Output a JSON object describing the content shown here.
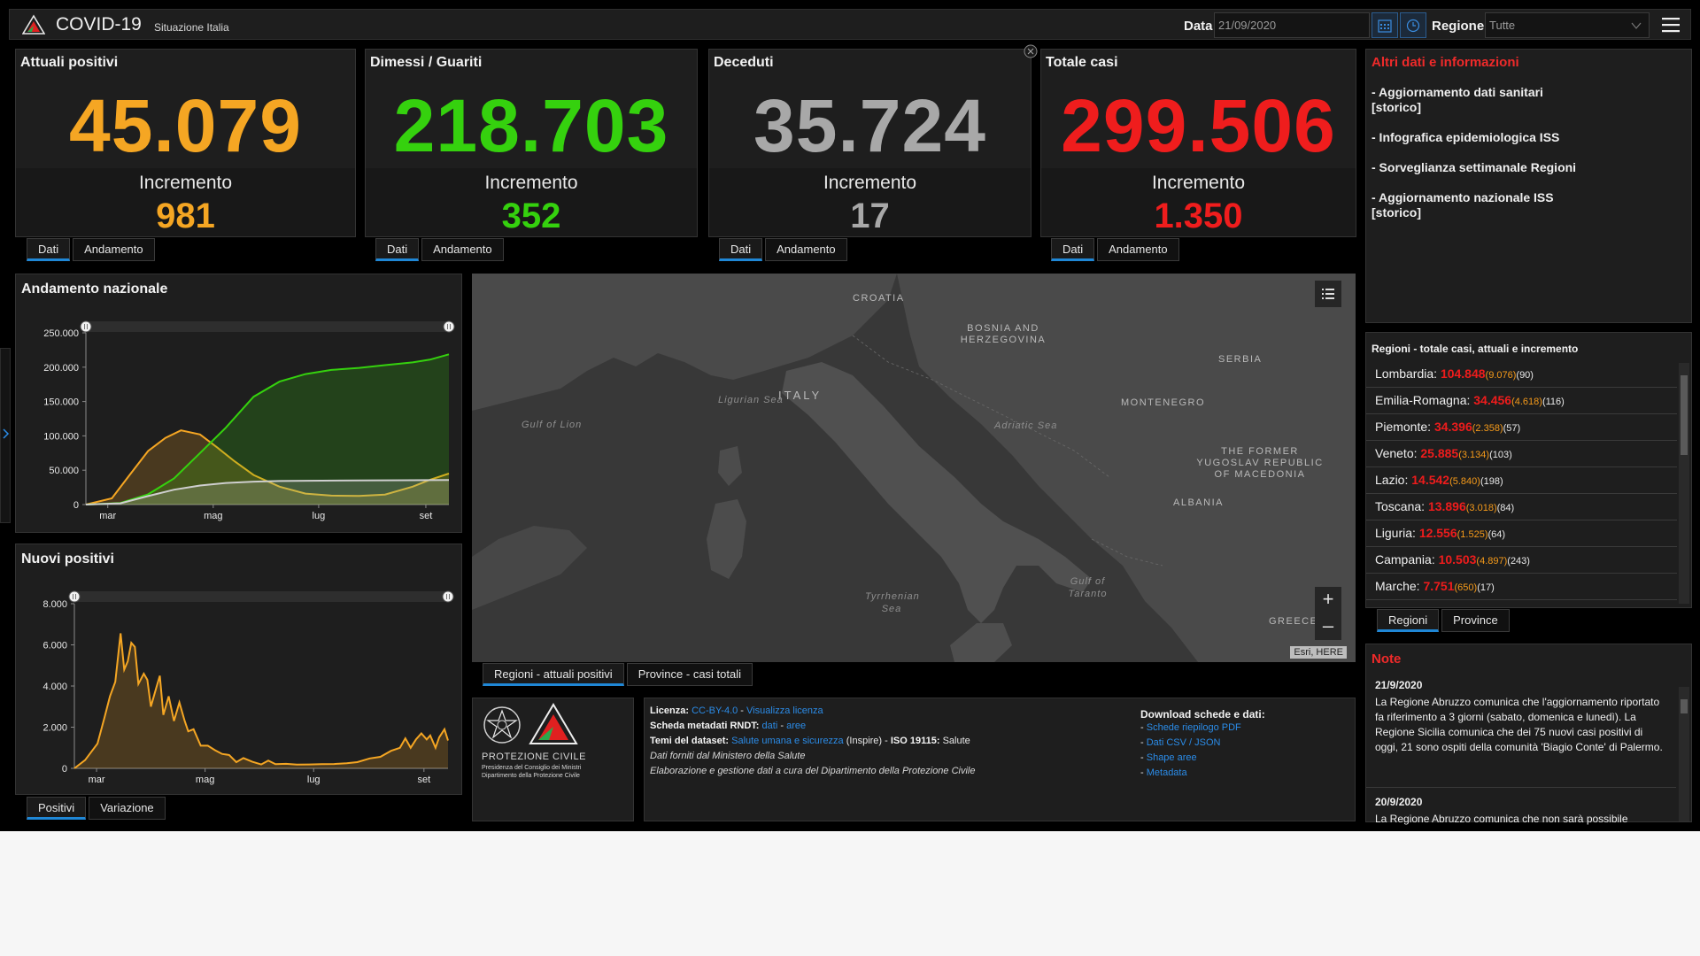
{
  "header": {
    "title": "COVID-19",
    "subtitle": "Situazione Italia",
    "date_label": "Data",
    "date_value": "21/09/2020",
    "region_label": "Regione",
    "region_value": "Tutte"
  },
  "kpis": [
    {
      "title": "Attuali positivi",
      "value": "45.079",
      "increment_label": "Incremento",
      "increment": "981",
      "color": "#f5a623"
    },
    {
      "title": "Dimessi / Guariti",
      "value": "218.703",
      "increment_label": "Incremento",
      "increment": "352",
      "color": "#35d10e"
    },
    {
      "title": "Deceduti",
      "value": "35.724",
      "increment_label": "Incremento",
      "increment": "17",
      "color": "#a8a8a8"
    },
    {
      "title": "Totale casi",
      "value": "299.506",
      "increment_label": "Incremento",
      "increment": "1.350",
      "color": "#ef1d1d"
    }
  ],
  "kpi_tabs": {
    "data": "Dati",
    "trend": "Andamento"
  },
  "info": {
    "title": "Altri dati e informazioni",
    "items": [
      "- Aggiornamento dati sanitari [storico]",
      "- Infografica epidemiologica ISS",
      "- Sorveglianza settimanale Regioni",
      "- Aggiornamento nazionale ISS [storico]"
    ]
  },
  "regions": {
    "title": "Regioni - totale casi, attuali e incremento",
    "rows": [
      {
        "name": "Lombardia:",
        "total": "104.848",
        "current": "(9.076)",
        "inc": "(90)"
      },
      {
        "name": "Emilia-Romagna:",
        "total": "34.456",
        "current": "(4.618)",
        "inc": "(116)"
      },
      {
        "name": "Piemonte:",
        "total": "34.396",
        "current": "(2.358)",
        "inc": "(57)"
      },
      {
        "name": "Veneto:",
        "total": "25.885",
        "current": "(3.134)",
        "inc": "(103)"
      },
      {
        "name": "Lazio:",
        "total": "14.542",
        "current": "(5.840)",
        "inc": "(198)"
      },
      {
        "name": "Toscana:",
        "total": "13.896",
        "current": "(3.018)",
        "inc": "(84)"
      },
      {
        "name": "Liguria:",
        "total": "12.556",
        "current": "(1.525)",
        "inc": "(64)"
      },
      {
        "name": "Campania:",
        "total": "10.503",
        "current": "(4.897)",
        "inc": "(243)"
      },
      {
        "name": "Marche:",
        "total": "7.751",
        "current": "(650)",
        "inc": "(17)"
      }
    ],
    "tabs": [
      "Regioni",
      "Province"
    ]
  },
  "notes": {
    "title": "Note",
    "items": [
      {
        "date": "21/9/2020",
        "text": "La Regione Abruzzo comunica che l'aggiornamento riportato fa riferimento a 3 giorni (sabato, domenica e lunedì). La Regione Sicilia comunica che dei 75 nuovi casi positivi di oggi, 21 sono ospiti della comunità 'Biagio Conte' di Palermo."
      },
      {
        "date": "20/9/2020",
        "text": "La Regione Abruzzo comunica che non sarà possibile"
      }
    ]
  },
  "national": {
    "title": "Andamento nazionale",
    "tabs": []
  },
  "new_positive": {
    "title": "Nuovi positivi",
    "tabs": [
      "Positivi",
      "Variazione"
    ]
  },
  "map": {
    "labels": {
      "croatia": "CROATIA",
      "bosnia": "BOSNIA AND HERZEGOVINA",
      "serbia": "SERBIA",
      "italy": "ITALY",
      "montenegro": "MONTENEGRO",
      "macedonia": "THE FORMER YUGOSLAV REPUBLIC OF MACEDONIA",
      "albania": "ALBANIA",
      "greece": "GREECE"
    },
    "seas": {
      "ligurian": "Ligurian Sea",
      "lion": "Gulf of Lion",
      "adriatic": "Adriatic Sea",
      "tyrrhenian": "Tyrrhenian Sea",
      "taranto": "Gulf of Taranto"
    },
    "attribution": "Esri, HERE",
    "zoom_in": "+",
    "zoom_out": "–",
    "tabs": [
      "Regioni - attuali positivi",
      "Province - casi totali"
    ]
  },
  "license": {
    "l1_label": "Licenza:",
    "l1_link1": "CC-BY-4.0",
    "l1_sep": " - ",
    "l1_link2": "Visualizza licenza",
    "l2_label": "Scheda metadati RNDT:",
    "l2_link1": "dati",
    "l2_sep": " - ",
    "l2_link2": "aree",
    "l3_label": "Temi del dataset:",
    "l3_link": "Salute umana e sicurezza",
    "l3_rest1": " (Inspire) - ",
    "l3_bold": "ISO 19115:",
    "l3_rest2": " Salute",
    "l4": "Dati forniti dal Ministero della Salute",
    "l5": "Elaborazione e gestione dati a cura del Dipartimento della Protezione Civile",
    "download_title": "Download schede e dati:",
    "downloads": [
      "Schede riepilogo PDF",
      "Dati CSV / JSON",
      "Shape aree",
      "Metadata"
    ]
  },
  "protezione": {
    "name": "PROTEZIONE CIVILE",
    "line1": "Presidenza del Consiglio dei Ministri",
    "line2": "Dipartimento della Protezione Civile"
  },
  "colors": {
    "attuali": "#f5a623",
    "guariti": "#35d10e",
    "deceduti": "#a8a8a8",
    "totale": "#ef1d1d",
    "accent": "#1f87d6"
  },
  "chart_data": [
    {
      "type": "area",
      "title": "Andamento nazionale",
      "categories": [
        "mar",
        "mag",
        "lug",
        "set"
      ],
      "ylim": [
        0,
        250000
      ],
      "yticks": [
        "0",
        "50.000",
        "100.000",
        "150.000",
        "200.000",
        "250.000"
      ],
      "x_start": "2020-02-24",
      "x_end": "2020-09-21",
      "series": [
        {
          "color": "#f5a623",
          "points": [
            [
              "2020-02-24",
              0
            ],
            [
              "2020-03-10",
              9000
            ],
            [
              "2020-03-20",
              42000
            ],
            [
              "2020-03-31",
              78000
            ],
            [
              "2020-04-10",
              97000
            ],
            [
              "2020-04-19",
              108000
            ],
            [
              "2020-04-30",
              102000
            ],
            [
              "2020-05-10",
              83000
            ],
            [
              "2020-05-20",
              63000
            ],
            [
              "2020-05-31",
              43000
            ],
            [
              "2020-06-15",
              26000
            ],
            [
              "2020-06-30",
              16000
            ],
            [
              "2020-07-15",
              13000
            ],
            [
              "2020-07-31",
              12500
            ],
            [
              "2020-08-15",
              14500
            ],
            [
              "2020-08-31",
              26000
            ],
            [
              "2020-09-10",
              36000
            ],
            [
              "2020-09-21",
              45079
            ]
          ]
        },
        {
          "color": "#35d10e",
          "points": [
            [
              "2020-02-24",
              0
            ],
            [
              "2020-03-15",
              2300
            ],
            [
              "2020-03-31",
              15000
            ],
            [
              "2020-04-15",
              38000
            ],
            [
              "2020-04-30",
              75000
            ],
            [
              "2020-05-15",
              112000
            ],
            [
              "2020-05-31",
              157000
            ],
            [
              "2020-06-15",
              179000
            ],
            [
              "2020-06-30",
              190000
            ],
            [
              "2020-07-15",
              196000
            ],
            [
              "2020-07-31",
              199000
            ],
            [
              "2020-08-15",
              203000
            ],
            [
              "2020-08-31",
              207000
            ],
            [
              "2020-09-10",
              211000
            ],
            [
              "2020-09-21",
              218703
            ]
          ]
        },
        {
          "color": "#cfcfcf",
          "points": [
            [
              "2020-02-24",
              0
            ],
            [
              "2020-03-15",
              1800
            ],
            [
              "2020-03-31",
              12400
            ],
            [
              "2020-04-15",
              21600
            ],
            [
              "2020-04-30",
              27700
            ],
            [
              "2020-05-15",
              31400
            ],
            [
              "2020-05-31",
              33400
            ],
            [
              "2020-06-15",
              34300
            ],
            [
              "2020-06-30",
              34700
            ],
            [
              "2020-07-31",
              35100
            ],
            [
              "2020-08-31",
              35480
            ],
            [
              "2020-09-21",
              35724
            ]
          ]
        }
      ]
    },
    {
      "type": "area",
      "title": "Nuovi positivi",
      "categories": [
        "mar",
        "mag",
        "lug",
        "set"
      ],
      "ylim": [
        0,
        8000
      ],
      "yticks": [
        "0",
        "2.000",
        "4.000",
        "6.000",
        "8.000"
      ],
      "x_start": "2020-02-24",
      "x_end": "2020-09-21",
      "series": [
        {
          "color": "#f5a623",
          "points": [
            [
              "2020-02-24",
              0
            ],
            [
              "2020-03-01",
              400
            ],
            [
              "2020-03-08",
              1200
            ],
            [
              "2020-03-12",
              2500
            ],
            [
              "2020-03-15",
              3500
            ],
            [
              "2020-03-18",
              4200
            ],
            [
              "2020-03-21",
              6557
            ],
            [
              "2020-03-23",
              4800
            ],
            [
              "2020-03-25",
              5200
            ],
            [
              "2020-03-27",
              6100
            ],
            [
              "2020-03-29",
              5900
            ],
            [
              "2020-03-31",
              4100
            ],
            [
              "2020-04-03",
              4600
            ],
            [
              "2020-04-05",
              4300
            ],
            [
              "2020-04-07",
              3000
            ],
            [
              "2020-04-10",
              3900
            ],
            [
              "2020-04-12",
              4500
            ],
            [
              "2020-04-14",
              2600
            ],
            [
              "2020-04-17",
              3500
            ],
            [
              "2020-04-20",
              2300
            ],
            [
              "2020-04-23",
              3200
            ],
            [
              "2020-04-26",
              2300
            ],
            [
              "2020-04-28",
              1800
            ],
            [
              "2020-05-01",
              1900
            ],
            [
              "2020-05-05",
              1100
            ],
            [
              "2020-05-09",
              1100
            ],
            [
              "2020-05-13",
              880
            ],
            [
              "2020-05-17",
              700
            ],
            [
              "2020-05-21",
              650
            ],
            [
              "2020-05-25",
              300
            ],
            [
              "2020-05-29",
              500
            ],
            [
              "2020-06-03",
              320
            ],
            [
              "2020-06-08",
              190
            ],
            [
              "2020-06-12",
              380
            ],
            [
              "2020-06-16",
              200
            ],
            [
              "2020-06-22",
              220
            ],
            [
              "2020-06-28",
              180
            ],
            [
              "2020-07-05",
              190
            ],
            [
              "2020-07-12",
              200
            ],
            [
              "2020-07-19",
              210
            ],
            [
              "2020-07-26",
              250
            ],
            [
              "2020-08-01",
              300
            ],
            [
              "2020-08-08",
              480
            ],
            [
              "2020-08-14",
              560
            ],
            [
              "2020-08-20",
              850
            ],
            [
              "2020-08-25",
              1000
            ],
            [
              "2020-08-28",
              1460
            ],
            [
              "2020-08-31",
              1000
            ],
            [
              "2020-09-03",
              1400
            ],
            [
              "2020-09-06",
              1700
            ],
            [
              "2020-09-09",
              1400
            ],
            [
              "2020-09-11",
              1600
            ],
            [
              "2020-09-14",
              1000
            ],
            [
              "2020-09-16",
              1500
            ],
            [
              "2020-09-19",
              1900
            ],
            [
              "2020-09-21",
              1350
            ]
          ]
        }
      ]
    }
  ]
}
